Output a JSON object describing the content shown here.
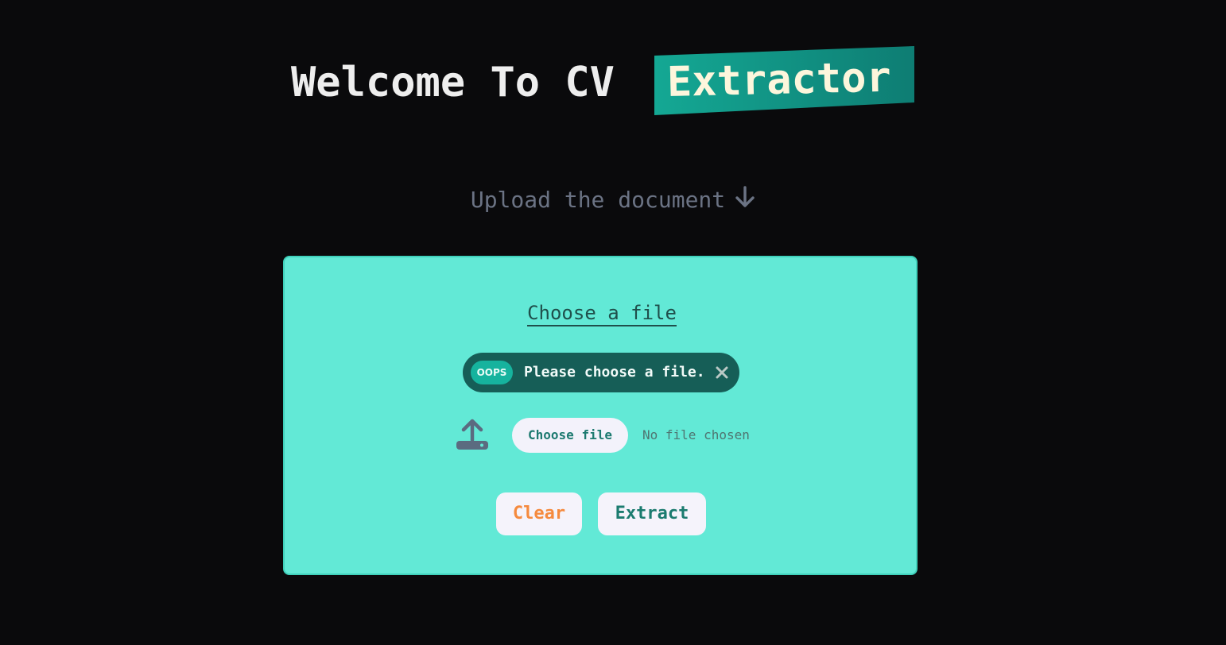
{
  "header": {
    "title_prefix": "Welcome To CV",
    "title_highlight": "Extractor",
    "highlight_color": "#14a493"
  },
  "upload": {
    "prompt": "Upload the document",
    "arrow_icon": "arrow-down-icon"
  },
  "card": {
    "background": "#62e9d6",
    "choose_label": "Choose a file",
    "alert": {
      "badge": "OOPS",
      "message": "Please choose a file.",
      "close_icon": "close-icon"
    },
    "file_input": {
      "icon": "upload-icon",
      "button_label": "Choose file",
      "status": "No file chosen"
    },
    "actions": {
      "clear_label": "Clear",
      "extract_label": "Extract",
      "clear_color": "#f58a3e",
      "extract_color": "#1b7b6f"
    }
  }
}
